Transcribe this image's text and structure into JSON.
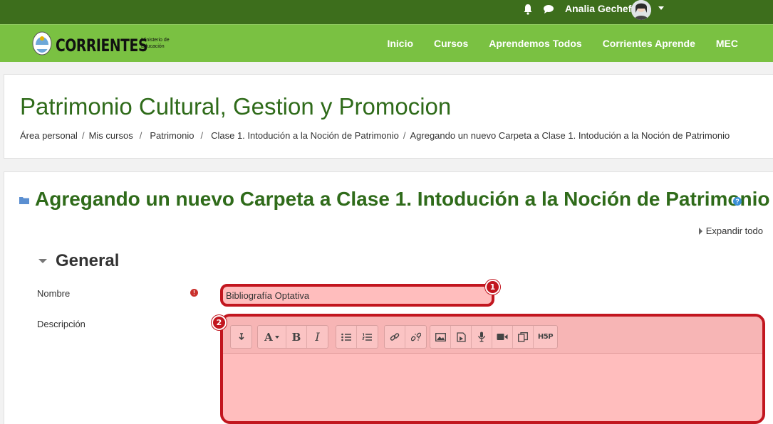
{
  "topbar": {
    "user_name": "Analia Gecheff",
    "icons": [
      "bell-icon",
      "chat-icon",
      "chevron-down-icon"
    ]
  },
  "navbar": {
    "brand": "CORRIENTES",
    "brand_sub_line1": "Ministerio de",
    "brand_sub_line2": "Educación",
    "links": [
      "Inicio",
      "Cursos",
      "Aprendemos Todos",
      "Corrientes Aprende",
      "MEC"
    ]
  },
  "header": {
    "title": "Patrimonio Cultural, Gestion y Promocion",
    "breadcrumb": [
      "Área personal",
      "Mis cursos",
      "Patrimonio",
      "Clase 1. Intodución a la Noción de Patrimonio",
      "Agregando un nuevo Carpeta a Clase 1. Intodución a la Noción de Patrimonio"
    ],
    "separator": "/"
  },
  "form": {
    "title": "Agregando un nuevo Carpeta a Clase 1. Intodución a la Noción de Patrimonio",
    "expand_all": "Expandir todo",
    "section": "General",
    "name_label": "Nombre",
    "name_value": "Bibliografía Optativa",
    "description_label": "Descripción",
    "badge_1": "1",
    "badge_2": "2",
    "help_glyph": "?",
    "required_glyph": "!"
  },
  "toolbar": {
    "groups": [
      [
        "collapse-icon"
      ],
      [
        "font-style-icon",
        "bold-icon",
        "italic-icon"
      ],
      [
        "unordered-list-icon",
        "ordered-list-icon"
      ],
      [
        "link-icon",
        "unlink-icon"
      ],
      [
        "image-icon",
        "media-icon",
        "record-audio-icon",
        "record-video-icon",
        "manage-files-icon",
        "h5p-icon"
      ]
    ],
    "bold_glyph": "B",
    "italic_glyph": "I",
    "font_glyph": "A",
    "h5p_label": "H5P"
  },
  "colors": {
    "topbar": "#3d6e1c",
    "navbar": "#7ac142",
    "title_green": "#2f6b1a",
    "highlight_red": "#c2161f",
    "highlight_fill": "#ffbdbd"
  }
}
